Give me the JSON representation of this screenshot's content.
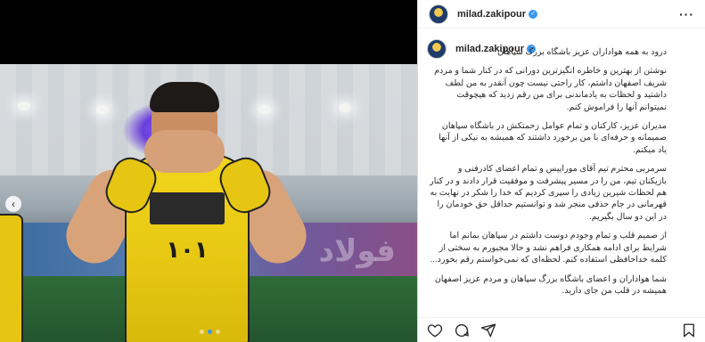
{
  "post": {
    "username": "milad.zakipour",
    "verified_icon": "verified-badge-icon",
    "more_icon": "more-options-icon"
  },
  "media": {
    "nav_prev_glyph": "‹",
    "banner_text": "فولاد",
    "jersey_text": "۱۰۱",
    "slides": 3,
    "current_slide": 2
  },
  "caption": {
    "username": "milad.zakipour",
    "paragraphs": [
      "درود به همه هواداران عزیز باشگاه بزرگ سپاهان",
      "نوشتن از بهترین و خاطره انگیزترین دورانی که در کنار شما و مردم شریف اصفهان داشتم، کار راحتی نیست چون آنقدر به من لطف داشتید و لحظات به یادماندنی برای من رقم زدید که هیچوقت نمیتوانم آنها را فراموش کنم.",
      "مدیران عزیز، کارکنان و تمام عوامل زحمتکش در باشگاه سپاهان صمیمانه و حرفه‌ای با من برخورد داشتند که همیشه به نیکی از آنها یاد میکنم.",
      "سرمربی محترم تیم آقای موراییس و تمام اعضای کادرفنی و بازیکنان تیم، من را در مسیر پیشرفت و موفقیت قرار دادند و در کنار هم لحظات شیرین زیادی را سپری کردیم که خدا را شکر در نهایت به قهرمانی در جام حذفی منجر شد و توانستیم حداقل حق خودمان را در این دو سال بگیریم.",
      "از صمیم قلب و تمام وجودم دوست داشتم در سپاهان بمانم اما شرایط برای ادامه همکاری فراهم نشد و حالا مجبورم به سختی از کلمه خداحافظی استفاده کنم. لحظه‌ای که نمی‌خواستم رقم بخورد...",
      "شما هواداران و اعضای باشگاه بزرگ سپاهان و مردم عزیز اصفهان همیشه در قلب من جای دارید."
    ]
  },
  "actions": {
    "like_icon": "heart-icon",
    "comment_icon": "comment-icon",
    "share_icon": "share-icon",
    "save_icon": "bookmark-icon"
  }
}
